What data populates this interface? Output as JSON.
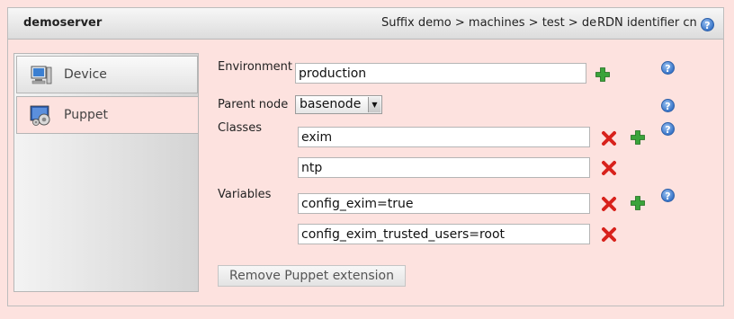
{
  "window": {
    "title": "demoserver",
    "suffix": "Suffix demo > machines > test > de",
    "rdn": "RDN identifier cn"
  },
  "tabs": [
    {
      "label": "Device",
      "icon": "computer-icon"
    },
    {
      "label": "Puppet",
      "icon": "puppet-gear-icon"
    }
  ],
  "form": {
    "environment_label": "Environment",
    "environment_value": "production",
    "parent_label": "Parent node",
    "parent_value": "basenode",
    "classes_label": "Classes",
    "classes": [
      "exim",
      "ntp"
    ],
    "variables_label": "Variables",
    "variables": [
      "config_exim=true",
      "config_exim_trusted_users=root"
    ],
    "remove_button": "Remove Puppet extension"
  },
  "colors": {
    "background": "#fde2df",
    "add_icon": "#3aa33a",
    "remove_icon": "#d8221c",
    "help_icon": "#3a76c9"
  }
}
